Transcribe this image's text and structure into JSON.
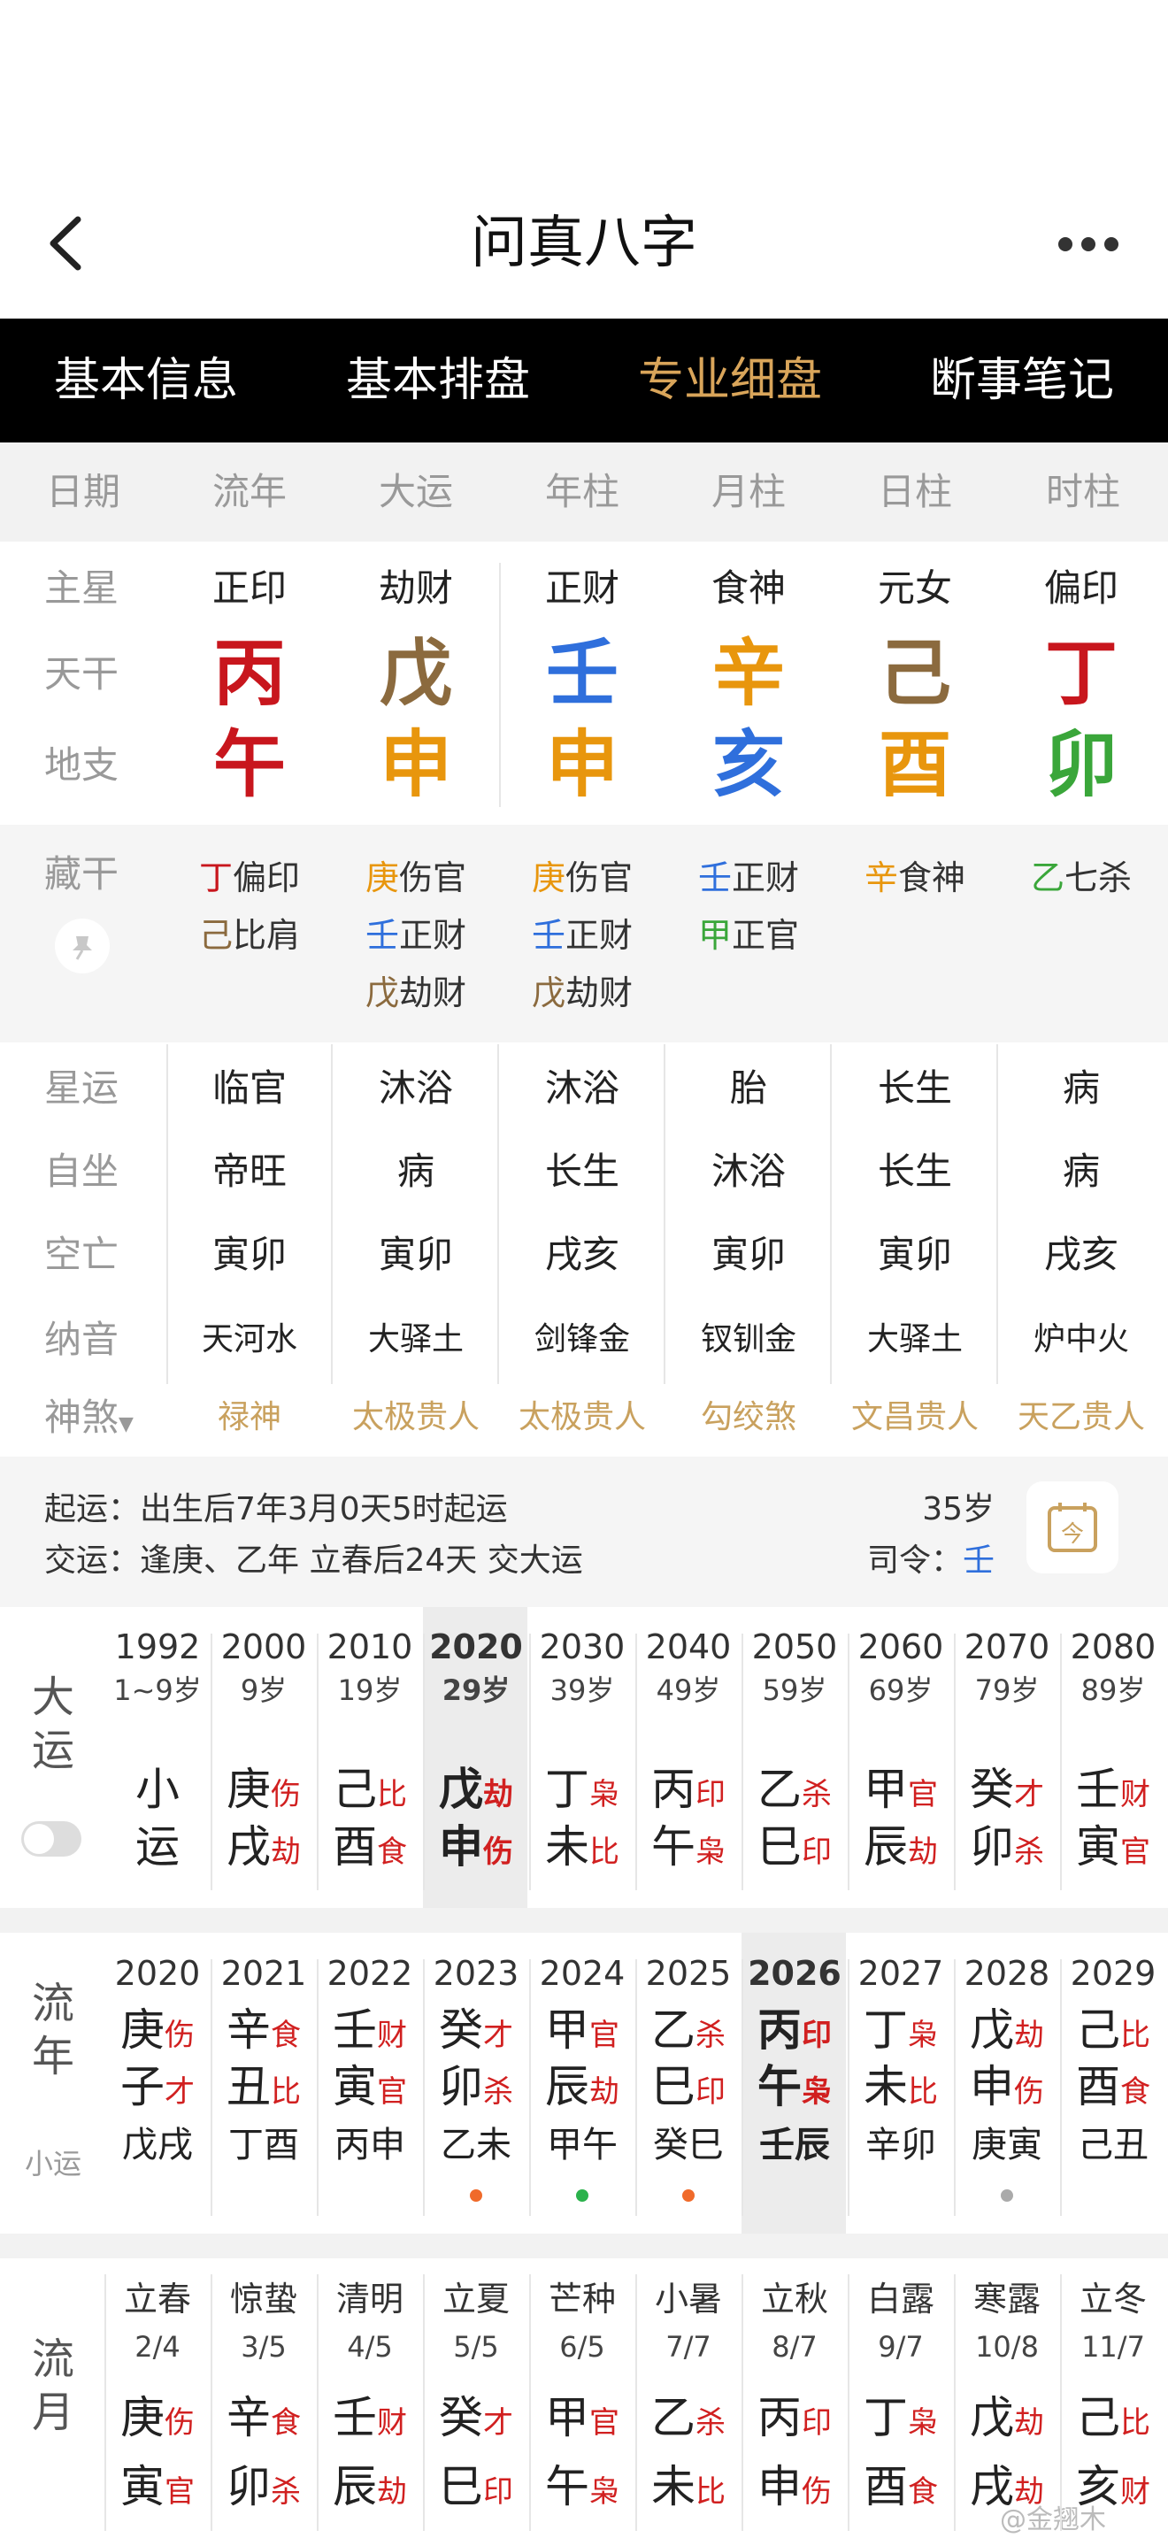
{
  "app": {
    "title": "问真八字"
  },
  "tabs": [
    "基本信息",
    "基本排盘",
    "专业细盘",
    "断事笔记"
  ],
  "active_tab": 2,
  "pillar_header": [
    "日期",
    "流年",
    "大运",
    "年柱",
    "月柱",
    "日柱",
    "时柱"
  ],
  "row_labels": {
    "main_star": "主星",
    "heaven": "天干",
    "earth": "地支",
    "hidden": "藏干",
    "star_luck": "星运",
    "self_seat": "自坐",
    "void": "空亡",
    "nayin": "纳音",
    "shensha": "神煞"
  },
  "main_star": [
    "正印",
    "劫财",
    "正财",
    "食神",
    "元女",
    "偏印"
  ],
  "heaven_stems": [
    {
      "char": "丙",
      "color": "#c8161d"
    },
    {
      "char": "戊",
      "color": "#8b6a3e"
    },
    {
      "char": "壬",
      "color": "#2f6fdc"
    },
    {
      "char": "辛",
      "color": "#e8960d"
    },
    {
      "char": "己",
      "color": "#8b6a3e"
    },
    {
      "char": "丁",
      "color": "#c8161d"
    }
  ],
  "earth_branches": [
    {
      "char": "午",
      "color": "#c8161d"
    },
    {
      "char": "申",
      "color": "#e8960d"
    },
    {
      "char": "申",
      "color": "#e8960d"
    },
    {
      "char": "亥",
      "color": "#2f6fdc"
    },
    {
      "char": "酉",
      "color": "#e8960d"
    },
    {
      "char": "卯",
      "color": "#3aa63a"
    }
  ],
  "hidden_stems": [
    [
      {
        "stem": "丁",
        "god": "偏印",
        "color": "#c8161d"
      },
      {
        "stem": "己",
        "god": "比肩",
        "color": "#8b6a3e"
      }
    ],
    [
      {
        "stem": "庚",
        "god": "伤官",
        "color": "#e8960d"
      },
      {
        "stem": "壬",
        "god": "正财",
        "color": "#2f6fdc"
      },
      {
        "stem": "戊",
        "god": "劫财",
        "color": "#8b6a3e"
      }
    ],
    [
      {
        "stem": "庚",
        "god": "伤官",
        "color": "#e8960d"
      },
      {
        "stem": "壬",
        "god": "正财",
        "color": "#2f6fdc"
      },
      {
        "stem": "戊",
        "god": "劫财",
        "color": "#8b6a3e"
      }
    ],
    [
      {
        "stem": "壬",
        "god": "正财",
        "color": "#2f6fdc"
      },
      {
        "stem": "甲",
        "god": "正官",
        "color": "#3aa63a"
      }
    ],
    [
      {
        "stem": "辛",
        "god": "食神",
        "color": "#e8960d"
      }
    ],
    [
      {
        "stem": "乙",
        "god": "七杀",
        "color": "#3aa63a"
      }
    ]
  ],
  "star_luck": [
    "临官",
    "沐浴",
    "沐浴",
    "胎",
    "长生",
    "病"
  ],
  "self_seat": [
    "帝旺",
    "病",
    "长生",
    "沐浴",
    "长生",
    "病"
  ],
  "void": [
    "寅卯",
    "寅卯",
    "戌亥",
    "寅卯",
    "寅卯",
    "戌亥"
  ],
  "nayin": [
    "天河水",
    "大驿土",
    "剑锋金",
    "钗钏金",
    "大驿土",
    "炉中火"
  ],
  "shensha": [
    "禄神",
    "太极贵人",
    "太极贵人",
    "勾绞煞",
    "文昌贵人",
    "天乙贵人"
  ],
  "qiyun": {
    "line1": "起运：出生后7年3月0天5时起运",
    "line2": "交运：逢庚、乙年 立春后24天 交大运",
    "age": "35岁",
    "siling_label": "司令：",
    "siling_value": "壬",
    "calendar_glyph": "今"
  },
  "dayun": {
    "label": [
      "大",
      "运"
    ],
    "columns": [
      {
        "year": "1992",
        "age": "1~9岁",
        "stem": "小",
        "branch": "运",
        "stem_god": "",
        "branch_god": ""
      },
      {
        "year": "2000",
        "age": "9岁",
        "stem": "庚",
        "branch": "戌",
        "stem_god": "伤",
        "branch_god": "劫"
      },
      {
        "year": "2010",
        "age": "19岁",
        "stem": "己",
        "branch": "酉",
        "stem_god": "比",
        "branch_god": "食"
      },
      {
        "year": "2020",
        "age": "29岁",
        "stem": "戊",
        "branch": "申",
        "stem_god": "劫",
        "branch_god": "伤",
        "current": true
      },
      {
        "year": "2030",
        "age": "39岁",
        "stem": "丁",
        "branch": "未",
        "stem_god": "枭",
        "branch_god": "比"
      },
      {
        "year": "2040",
        "age": "49岁",
        "stem": "丙",
        "branch": "午",
        "stem_god": "印",
        "branch_god": "枭"
      },
      {
        "year": "2050",
        "age": "59岁",
        "stem": "乙",
        "branch": "巳",
        "stem_god": "杀",
        "branch_god": "印"
      },
      {
        "year": "2060",
        "age": "69岁",
        "stem": "甲",
        "branch": "辰",
        "stem_god": "官",
        "branch_god": "劫"
      },
      {
        "year": "2070",
        "age": "79岁",
        "stem": "癸",
        "branch": "卯",
        "stem_god": "才",
        "branch_god": "杀"
      },
      {
        "year": "2080",
        "age": "89岁",
        "stem": "壬",
        "branch": "寅",
        "stem_god": "财",
        "branch_god": "官"
      }
    ]
  },
  "liunian": {
    "label": [
      "流",
      "年"
    ],
    "sublabel": "小运",
    "columns": [
      {
        "year": "2020",
        "stem": "庚",
        "branch": "子",
        "stem_god": "伤",
        "branch_god": "才",
        "xiaoyun": "戊戌",
        "dot": ""
      },
      {
        "year": "2021",
        "stem": "辛",
        "branch": "丑",
        "stem_god": "食",
        "branch_god": "比",
        "xiaoyun": "丁酉",
        "dot": ""
      },
      {
        "year": "2022",
        "stem": "壬",
        "branch": "寅",
        "stem_god": "财",
        "branch_god": "官",
        "xiaoyun": "丙申",
        "dot": ""
      },
      {
        "year": "2023",
        "stem": "癸",
        "branch": "卯",
        "stem_god": "才",
        "branch_god": "杀",
        "xiaoyun": "乙未",
        "dot": "#f06a2a"
      },
      {
        "year": "2024",
        "stem": "甲",
        "branch": "辰",
        "stem_god": "官",
        "branch_god": "劫",
        "xiaoyun": "甲午",
        "dot": "#2bb24c"
      },
      {
        "year": "2025",
        "stem": "乙",
        "branch": "巳",
        "stem_god": "杀",
        "branch_god": "印",
        "xiaoyun": "癸巳",
        "dot": "#f06a2a"
      },
      {
        "year": "2026",
        "stem": "丙",
        "branch": "午",
        "stem_god": "印",
        "branch_god": "枭",
        "xiaoyun": "壬辰",
        "dot": "",
        "current": true
      },
      {
        "year": "2027",
        "stem": "丁",
        "branch": "未",
        "stem_god": "枭",
        "branch_god": "比",
        "xiaoyun": "辛卯",
        "dot": ""
      },
      {
        "year": "2028",
        "stem": "戊",
        "branch": "申",
        "stem_god": "劫",
        "branch_god": "伤",
        "xiaoyun": "庚寅",
        "dot": "#aaaaaa"
      },
      {
        "year": "2029",
        "stem": "己",
        "branch": "酉",
        "stem_god": "比",
        "branch_god": "食",
        "xiaoyun": "己丑",
        "dot": ""
      }
    ]
  },
  "liuyue": {
    "label": [
      "流",
      "月"
    ],
    "columns": [
      {
        "term": "立春",
        "date": "2/4",
        "stem": "庚",
        "branch": "寅",
        "stem_god": "伤",
        "branch_god": "官"
      },
      {
        "term": "惊蛰",
        "date": "3/5",
        "stem": "辛",
        "branch": "卯",
        "stem_god": "食",
        "branch_god": "杀"
      },
      {
        "term": "清明",
        "date": "4/5",
        "stem": "壬",
        "branch": "辰",
        "stem_god": "财",
        "branch_god": "劫"
      },
      {
        "term": "立夏",
        "date": "5/5",
        "stem": "癸",
        "branch": "巳",
        "stem_god": "才",
        "branch_god": "印"
      },
      {
        "term": "芒种",
        "date": "6/5",
        "stem": "甲",
        "branch": "午",
        "stem_god": "官",
        "branch_god": "枭"
      },
      {
        "term": "小暑",
        "date": "7/7",
        "stem": "乙",
        "branch": "未",
        "stem_god": "杀",
        "branch_god": "比"
      },
      {
        "term": "立秋",
        "date": "8/7",
        "stem": "丙",
        "branch": "申",
        "stem_god": "印",
        "branch_god": "伤"
      },
      {
        "term": "白露",
        "date": "9/7",
        "stem": "丁",
        "branch": "酉",
        "stem_god": "枭",
        "branch_god": "食"
      },
      {
        "term": "寒露",
        "date": "10/8",
        "stem": "戊",
        "branch": "戌",
        "stem_god": "劫",
        "branch_god": "劫"
      },
      {
        "term": "立冬",
        "date": "11/7",
        "stem": "己",
        "branch": "亥",
        "stem_god": "比",
        "branch_god": "财"
      }
    ]
  },
  "watermark": "@金翘木"
}
